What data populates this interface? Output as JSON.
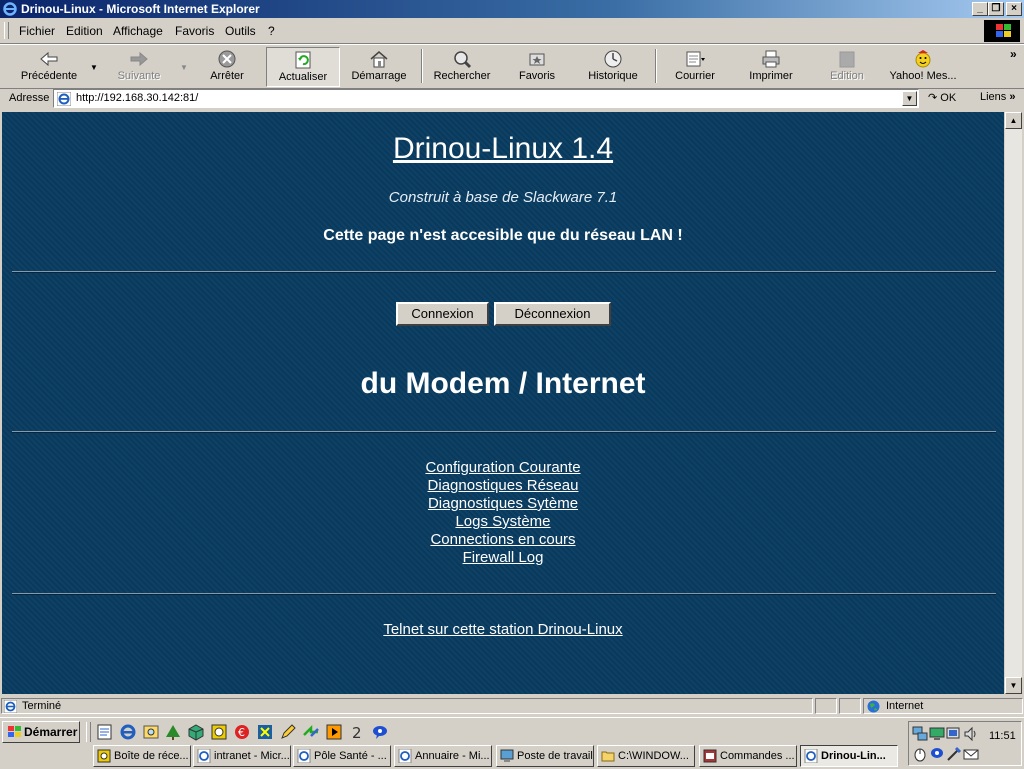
{
  "window": {
    "title": "Drinou-Linux - Microsoft Internet Explorer",
    "controls": {
      "minimize": "_",
      "maximize": "❐",
      "close": "×"
    }
  },
  "menu": [
    "Fichier",
    "Edition",
    "Affichage",
    "Favoris",
    "Outils",
    "?"
  ],
  "toolbar": {
    "back": "Précédente",
    "forward": "Suivante",
    "stop": "Arrêter",
    "refresh": "Actualiser",
    "home": "Démarrage",
    "search": "Rechercher",
    "favorites": "Favoris",
    "history": "Historique",
    "mail": "Courrier",
    "print": "Imprimer",
    "edit": "Edition",
    "messenger": "Yahoo! Mes...",
    "chevron": "»"
  },
  "address": {
    "label": "Adresse",
    "url": "http://192.168.30.142:81/",
    "go": "OK",
    "links": "Liens",
    "links_chevron": "»"
  },
  "page": {
    "title": "Drinou-Linux 1.4",
    "subtitle": "Construit à base de Slackware 7.1",
    "notice": "Cette page n'est accesible que du réseau LAN !",
    "connect_button": "Connexion",
    "disconnect_button": "Déconnexion",
    "modem_heading": "du Modem / Internet",
    "links": [
      "Configuration Courante",
      "Diagnostiques Réseau",
      "Diagnostiques Sytème",
      "Logs Système",
      "Connections en cours",
      "Firewall Log"
    ],
    "telnet_link": "Telnet sur cette station Drinou-Linux"
  },
  "status": {
    "text": "Terminé",
    "zone": "Internet"
  },
  "taskbar": {
    "start": "Démarrer",
    "tasks": [
      "Boîte de réce...",
      "intranet - Micr...",
      "Pôle Santé - ...",
      "Annuaire - Mi...",
      "Poste de travail",
      "C:\\WINDOW...",
      "Commandes ...",
      "Drinou-Lin..."
    ],
    "clock": "11:51"
  },
  "colors": {
    "page_background": "#083a5e",
    "title_bar": "#0a246a",
    "chrome": "#d4d0c8"
  }
}
